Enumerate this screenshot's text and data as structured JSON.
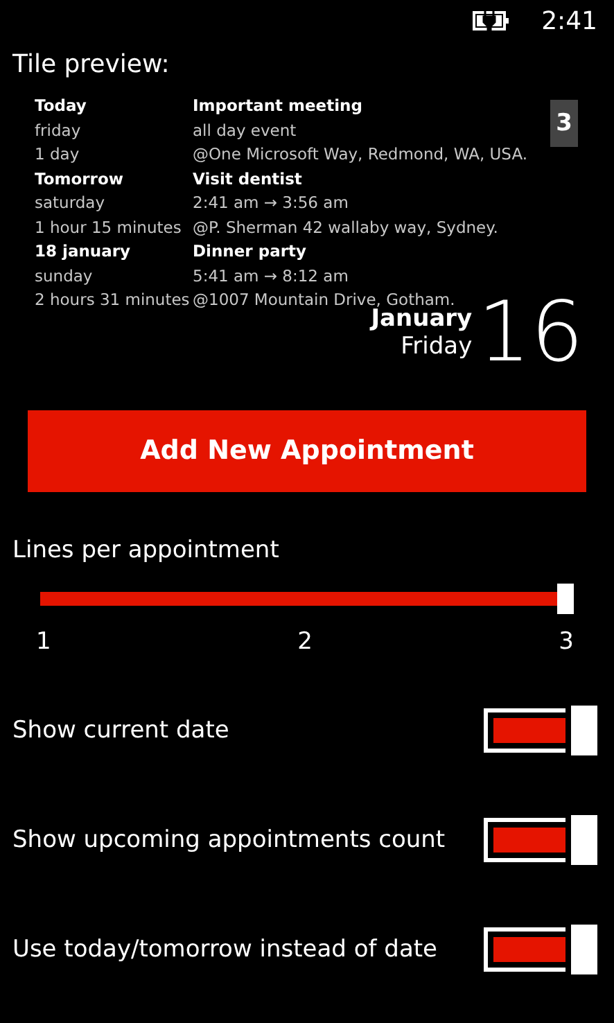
{
  "status_bar": {
    "time": "2:41"
  },
  "tile_preview": {
    "heading": "Tile preview:",
    "count_badge": "3",
    "appointments": [
      {
        "day": "Today",
        "weekday": "friday",
        "duration": "1 day",
        "title": "Important meeting",
        "time": "all day event",
        "location": "@One Microsoft Way, Redmond, WA, USA."
      },
      {
        "day": "Tomorrow",
        "weekday": "saturday",
        "duration": "1 hour 15 minutes",
        "title": "Visit dentist",
        "time": "2:41 am → 3:56 am",
        "location": "@P. Sherman 42 wallaby way, Sydney."
      },
      {
        "day": "18 january",
        "weekday": "sunday",
        "duration": "2 hours 31 minutes",
        "title": "Dinner party",
        "time": "5:41 am → 8:12 am",
        "location": "@1007 Mountain Drive, Gotham."
      }
    ],
    "date": {
      "month": "January",
      "weekday": "Friday",
      "day": "16"
    }
  },
  "add_button": "Add New Appointment",
  "lines_slider": {
    "label": "Lines per appointment",
    "level": 1,
    "ticks": [
      "1",
      "2",
      "3"
    ]
  },
  "toggles": [
    {
      "label": "Show current date",
      "on": true
    },
    {
      "label": "Show upcoming appointments count",
      "on": true
    },
    {
      "label": "Use today/tomorrow instead of date",
      "on": true
    }
  ]
}
